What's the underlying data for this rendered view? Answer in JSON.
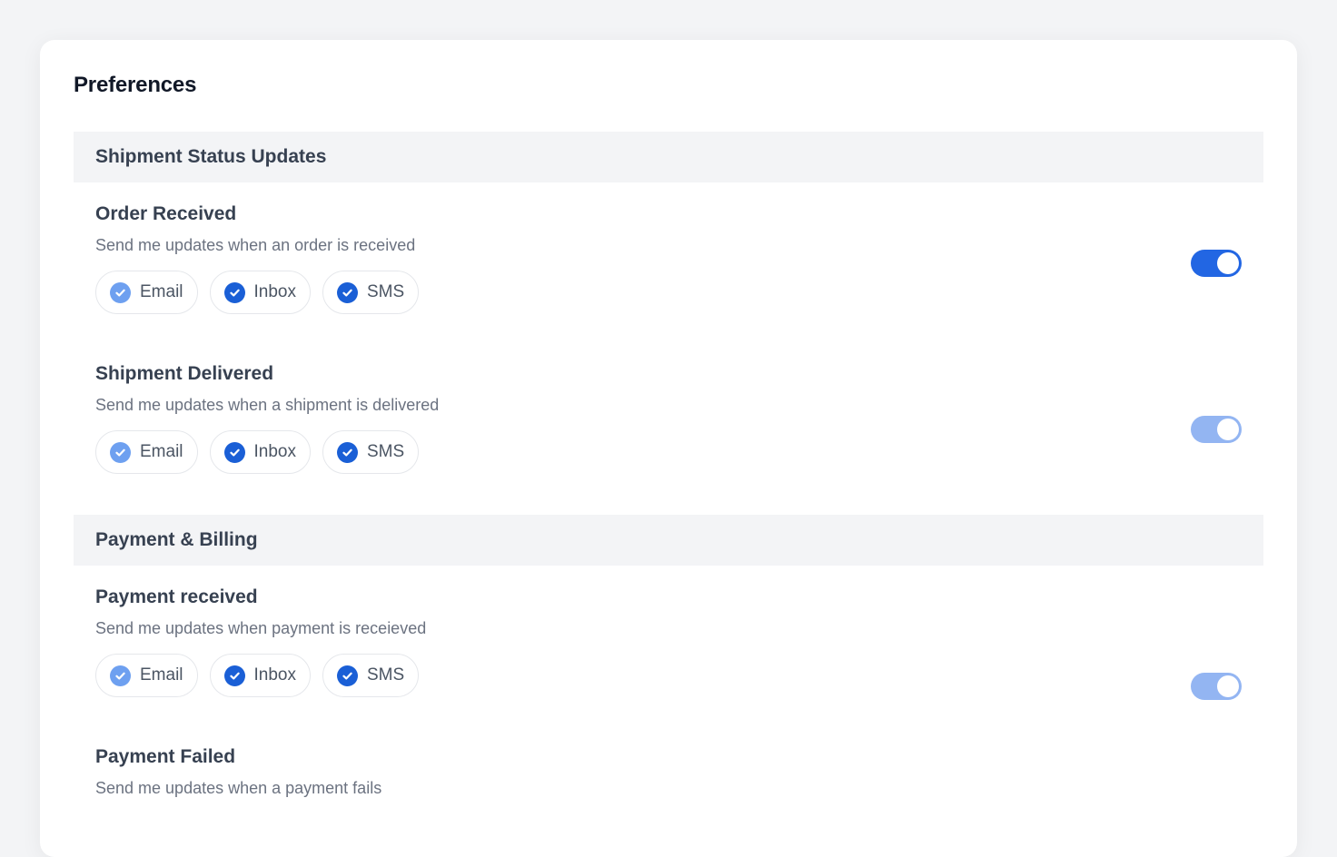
{
  "page": {
    "title": "Preferences"
  },
  "sections": [
    {
      "header": "Shipment Status Updates",
      "items": [
        {
          "title": "Order Received",
          "description": "Send me updates when an order is received",
          "channels": [
            "Email",
            "Inbox",
            "SMS"
          ],
          "toggle_state": "on"
        },
        {
          "title": "Shipment Delivered",
          "description": "Send me updates when a shipment is delivered",
          "channels": [
            "Email",
            "Inbox",
            "SMS"
          ],
          "toggle_state": "on-muted"
        }
      ]
    },
    {
      "header": "Payment & Billing",
      "items": [
        {
          "title": "Payment received",
          "description": "Send me updates when payment is receieved",
          "channels": [
            "Email",
            "Inbox",
            "SMS"
          ],
          "toggle_state": "on-muted"
        },
        {
          "title": "Payment Failed",
          "description": "Send me updates when a payment fails"
        }
      ]
    }
  ],
  "colors": {
    "accent": "#2266e3",
    "accent_muted": "#93b5f2",
    "check_light": "#6ea0f0",
    "check_dark": "#1a5fd6"
  }
}
